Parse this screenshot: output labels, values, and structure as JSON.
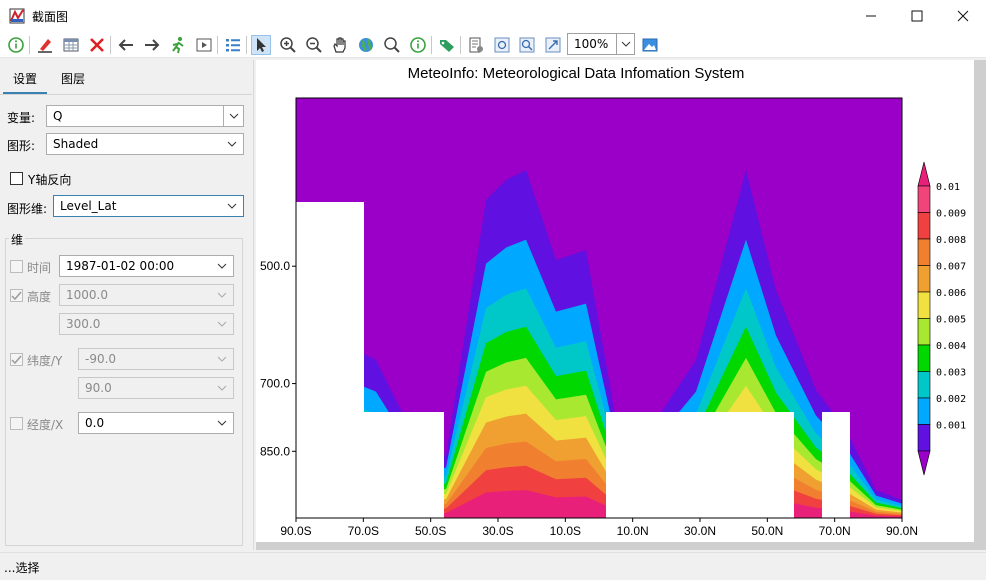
{
  "window": {
    "title": "截面图",
    "controls": {
      "minimize": "—",
      "maximize": "☐",
      "close": "✕"
    }
  },
  "toolbar": {
    "zoom_value": "100%",
    "icons": [
      "info-icon",
      "eraser-icon",
      "table-icon",
      "delete-icon",
      "arrow-left-icon",
      "arrow-right-icon",
      "run-man-icon",
      "play-frame-icon",
      "list-icon",
      "select-pointer-icon",
      "zoom-in-icon",
      "zoom-out-icon",
      "pan-hand-icon",
      "globe-icon",
      "magnifier-icon",
      "identify-icon",
      "label-tag-icon",
      "page-setup-icon",
      "zoom-extent-icon",
      "zoom-layer-icon",
      "full-extent-icon",
      "image-export-icon"
    ]
  },
  "tabs": [
    {
      "label": "设置"
    },
    {
      "label": "图层"
    }
  ],
  "settings": {
    "variable_label": "变量:",
    "variable_value": "Q",
    "graph_label": "图形:",
    "graph_value": "Shaded",
    "y_reverse_label": "Y轴反向",
    "plot_dim_label": "图形维:",
    "plot_dim_value": "Level_Lat",
    "dim_group_title": "维",
    "time_label": "时间",
    "time_value": "1987-01-02 00:00",
    "level_label": "高度",
    "level_from": "1000.0",
    "level_to": "300.0",
    "lat_label": "纬度/Y",
    "lat_from": "-90.0",
    "lat_to": "90.0",
    "lon_label": "经度/X",
    "lon_value": "0.0"
  },
  "chart_data": {
    "type": "contourf",
    "title": "MeteoInfo: Meteorological Data Infomation System",
    "x_ticks": [
      "90.0S",
      "70.0S",
      "50.0S",
      "30.0S",
      "10.0S",
      "10.0N",
      "30.0N",
      "50.0N",
      "70.0N",
      "90.0N"
    ],
    "y_ticks": [
      "500.0",
      "700.0",
      "850.0"
    ],
    "xlim": [
      -90,
      90
    ],
    "legend": {
      "labels": [
        "0.01",
        "0.009",
        "0.008",
        "0.007",
        "0.006",
        "0.005",
        "0.004",
        "0.003",
        "0.002",
        "0.001"
      ],
      "colors": [
        "#f0447a",
        "#f04040",
        "#f08030",
        "#f0a030",
        "#f0e040",
        "#a8e830",
        "#00d800",
        "#00c8c8",
        "#00a8ff",
        "#6010e0"
      ],
      "top_color": "#e8207a",
      "bottom_color": "#9b00c8"
    },
    "background_color": "#9b00c8"
  },
  "status": {
    "text": "...选择"
  }
}
